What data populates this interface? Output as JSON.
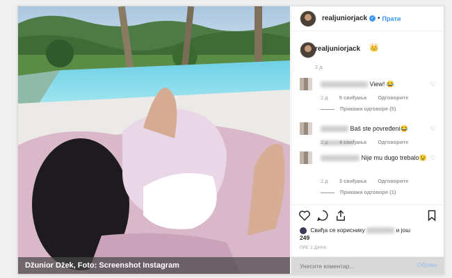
{
  "header": {
    "username": "realjuniorjack",
    "dot": "•",
    "follow_label": "Прати"
  },
  "owner_comment": {
    "username": "realjuniorjack",
    "emoji": "👑",
    "time": "2 д"
  },
  "comments": [
    {
      "text": "View! 😂",
      "time": "2 д",
      "likes": "5 свиђања",
      "reply": "Одговорите",
      "view_replies": "Прикажи одговоре (5)"
    },
    {
      "text": "Baš ste povređeni😂",
      "time": "2 д",
      "likes": "4 свиђања",
      "reply": "Одговорите"
    },
    {
      "text": "Nije mu dugo trebalo😉",
      "time": "2 д",
      "likes": "3 свиђања",
      "reply": "Одговорите",
      "view_replies": "Прикажи одговоре (1)"
    }
  ],
  "likes": {
    "prefix": "Свиђа се кориснику",
    "middle": "и још",
    "count": "249"
  },
  "posted_ago": "ПРЕ 2 ДАНА",
  "add_comment": {
    "placeholder": "Унесите коментар...",
    "post_label": "Објави"
  },
  "photo_caption": "Džunior Džek, Foto: Screenshot Instagram",
  "icons": [
    "heart-icon",
    "comment-icon",
    "share-icon",
    "bookmark-icon"
  ],
  "colors": {
    "link": "#3897f0",
    "text": "#262626",
    "muted": "#999999"
  }
}
